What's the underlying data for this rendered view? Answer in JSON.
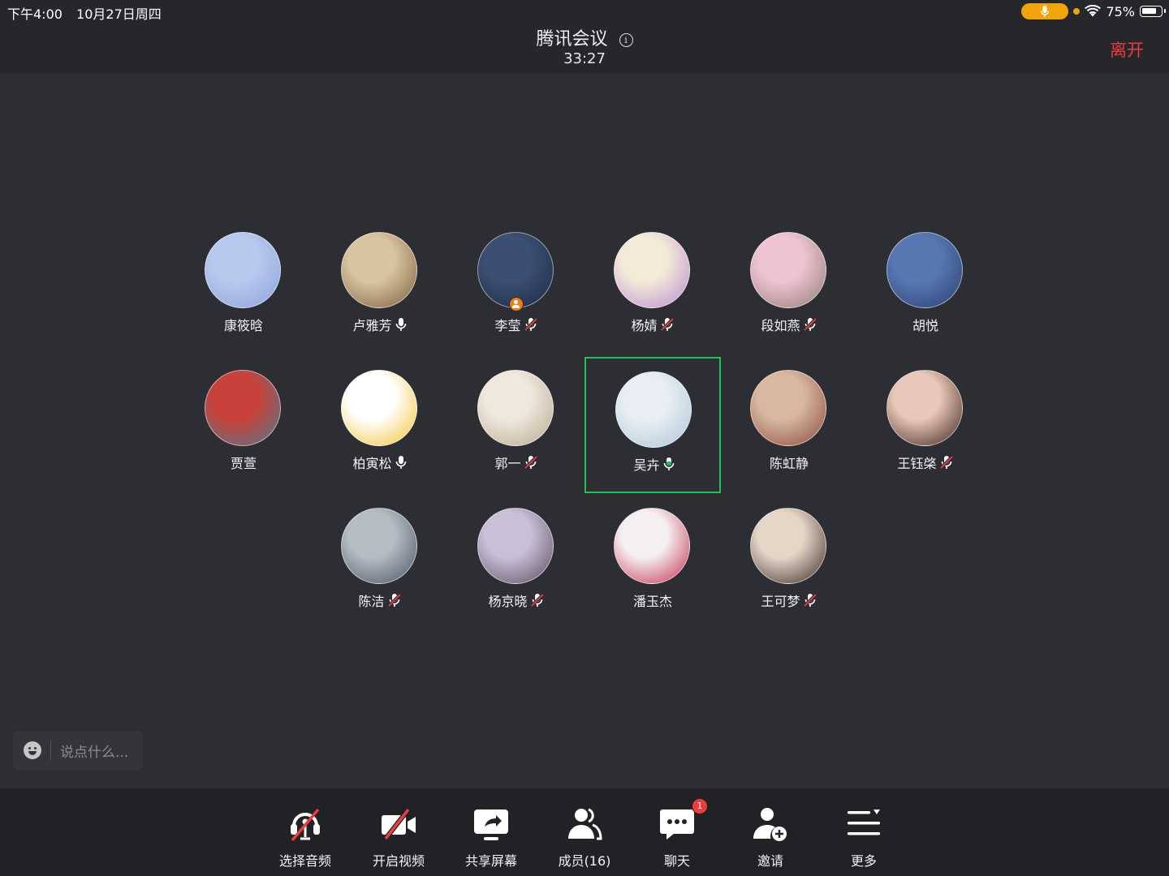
{
  "status_bar": {
    "time": "下午4:00",
    "date": "10月27日周四",
    "battery": "75%",
    "battery_level": 0.75
  },
  "header": {
    "title": "腾讯会议",
    "duration": "33:27",
    "leave_label": "离开"
  },
  "participants": [
    {
      "name": "康筱晗",
      "mic": "none",
      "host": false,
      "colors": [
        "#b8c9ef",
        "#8aa3d8"
      ]
    },
    {
      "name": "卢雅芳",
      "mic": "on",
      "host": false,
      "colors": [
        "#d8c4a0",
        "#7a5e3e"
      ]
    },
    {
      "name": "李莹",
      "mic": "muted",
      "host": true,
      "colors": [
        "#3b4f73",
        "#1d2a40"
      ]
    },
    {
      "name": "杨婧",
      "mic": "muted",
      "host": false,
      "colors": [
        "#f3ead8",
        "#b98ad2"
      ]
    },
    {
      "name": "段如燕",
      "mic": "muted",
      "host": false,
      "colors": [
        "#eec4d2",
        "#8e7c74"
      ]
    },
    {
      "name": "胡悦",
      "mic": "none",
      "host": false,
      "colors": [
        "#5878b4",
        "#2b3f6e"
      ]
    },
    {
      "name": "贾萱",
      "mic": "none",
      "host": false,
      "colors": [
        "#c8413a",
        "#4f7a8c"
      ]
    },
    {
      "name": "柏寅松",
      "mic": "on",
      "host": false,
      "colors": [
        "#ffffff",
        "#f3c232"
      ]
    },
    {
      "name": "郭一",
      "mic": "muted",
      "host": false,
      "colors": [
        "#efe8dc",
        "#b8a890"
      ]
    },
    {
      "name": "吴卉",
      "mic": "speaking",
      "host": false,
      "active": true,
      "colors": [
        "#e8eef3",
        "#a9c6d8"
      ]
    },
    {
      "name": "陈虹静",
      "mic": "none",
      "host": false,
      "colors": [
        "#d8b8a0",
        "#8a4a3a"
      ]
    },
    {
      "name": "王钰棨",
      "mic": "muted",
      "host": false,
      "colors": [
        "#e8c8b8",
        "#3a2018"
      ]
    },
    {
      "name": "陈洁",
      "mic": "muted",
      "host": false,
      "colors": [
        "#b4bcc4",
        "#4a5460"
      ]
    },
    {
      "name": "杨京晓",
      "mic": "muted",
      "host": false,
      "colors": [
        "#c8c0d8",
        "#5a4a5a"
      ]
    },
    {
      "name": "潘玉杰",
      "mic": "none",
      "host": false,
      "colors": [
        "#f4f0f2",
        "#c42a48"
      ]
    },
    {
      "name": "王可梦",
      "mic": "muted",
      "host": false,
      "colors": [
        "#e6d6c8",
        "#3a2820"
      ]
    }
  ],
  "chat_input": {
    "placeholder": "说点什么..."
  },
  "toolbar": {
    "items": [
      {
        "label": "选择音频",
        "icon": "headset-off-icon"
      },
      {
        "label": "开启视频",
        "icon": "camera-off-icon"
      },
      {
        "label": "共享屏幕",
        "icon": "share-screen-icon"
      },
      {
        "label": "成员(16)",
        "icon": "members-icon"
      },
      {
        "label": "聊天",
        "icon": "chat-icon",
        "badge": "1"
      },
      {
        "label": "邀请",
        "icon": "invite-icon"
      },
      {
        "label": "更多",
        "icon": "more-icon"
      }
    ]
  }
}
